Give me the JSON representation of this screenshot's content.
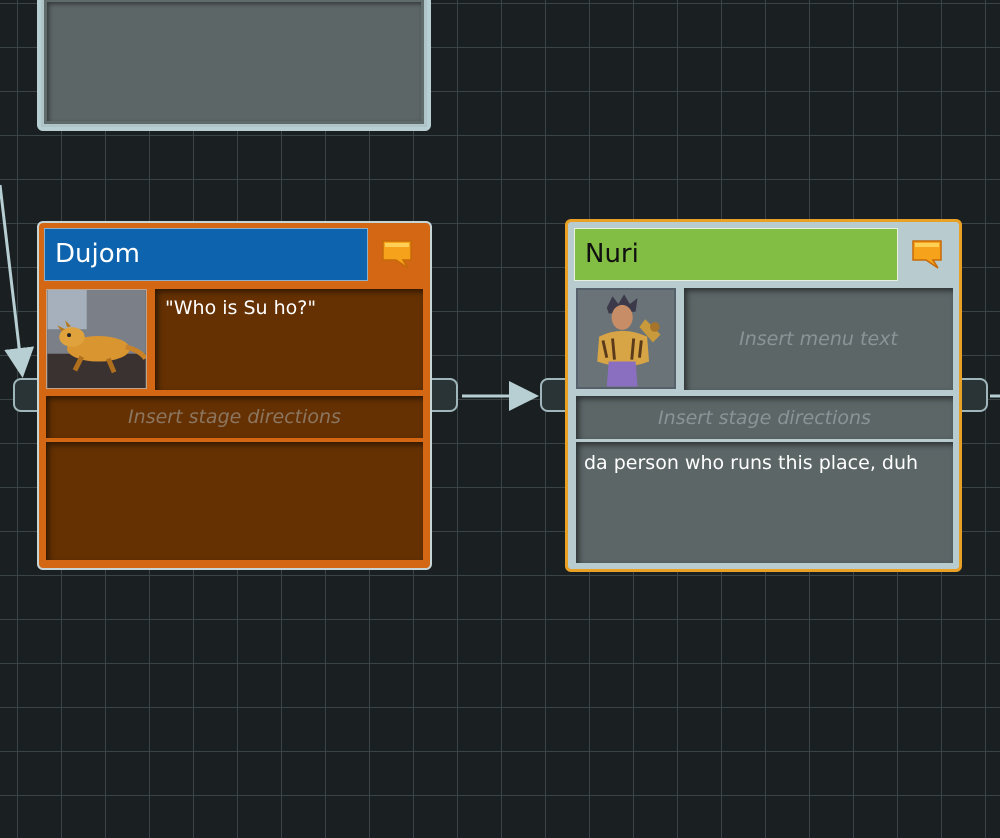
{
  "nodes": {
    "dujom": {
      "speaker": "Dujom",
      "menu_text": "\"Who is Su ho?\"",
      "stage_placeholder": "Insert stage directions",
      "dialog_text": "",
      "header_color": "#0d63ad",
      "body_color": "#d46714",
      "portrait_icon": "bearded-dragon-portrait"
    },
    "nuri": {
      "speaker": "Nuri",
      "menu_placeholder": "Insert menu text",
      "stage_placeholder": "Insert stage directions",
      "dialog_text": "da person who runs this place, duh",
      "header_color": "#82be43",
      "body_color": "#b8ccd0",
      "portrait_icon": "character-portrait"
    }
  },
  "icons": {
    "speech": "speech-bubble-icon",
    "arrow": "arrow-icon"
  },
  "colors": {
    "canvas": "#1a2022",
    "grid": "#3a4446",
    "wire": "#b7cfd3",
    "selected_border": "#e8a025"
  }
}
